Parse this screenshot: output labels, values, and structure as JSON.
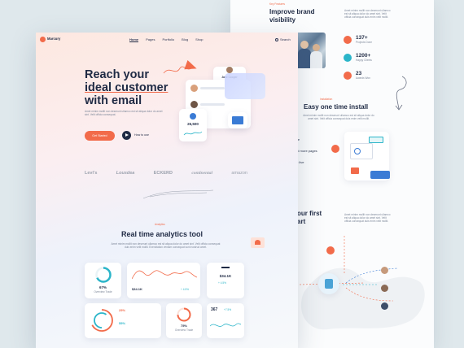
{
  "colors": {
    "accent": "#f26b4a",
    "dark": "#1f2a44",
    "teal": "#2bb5c9",
    "blue": "#3a7bd5",
    "muted": "#8a93a6"
  },
  "brand": {
    "name": "Marcury"
  },
  "nav": {
    "items": [
      "Home",
      "Pages",
      "Portfolio",
      "Blog",
      "Shop"
    ],
    "search": "Search"
  },
  "hero": {
    "line1": "Reach your",
    "line2": "ideal customer",
    "line3": "with email",
    "desc": "Amet minim mollit non deserunt ullamco est sit aliqua dolor do amet sint. Velit officia consequat.",
    "cta": "Get Started",
    "how": "How to use",
    "contact_name": "Jane Cooper",
    "stat": "26,500"
  },
  "logos": [
    "Levi's",
    "Lousdea",
    "ECKERD",
    "continental",
    "amazon"
  ],
  "analytics": {
    "tag": "Analytics",
    "title": "Real time analytics tool",
    "desc": "Amet minim mollit non deserunt ullamco est sit aliqua dolor do amet sint. Velit officia consequat duis enim velit mollit. Exercitation veniam consequat sunt nostrud amet.",
    "donut_value": "67%",
    "donut_label": "Overview Trade",
    "line_value": "$34.1K",
    "line_change": "+ 4.5%",
    "bar_value": "$34.1K",
    "bar_change": "+ 4.5%",
    "pct1": "25%",
    "pct2": "55%",
    "ring_value": "75%",
    "ring_label": "Overview Trade",
    "count_value": "367",
    "count_change": "+7.5%"
  },
  "back": {
    "feat_tag": "Key Features",
    "title1": "Improve brand",
    "title2": "visibility",
    "text": "Amet minim mollit non deserunt ullamco est sit aliqua dolor do amet sint. Velit officia consequat duis enim velit mollit.",
    "stats": [
      {
        "value": "137+",
        "label": "Projects Done"
      },
      {
        "value": "1200+",
        "label": "Happy Clients"
      },
      {
        "value": "23",
        "label": "Awards Won"
      }
    ],
    "install_tag": "Installation",
    "install_title": "Easy one time install",
    "install_desc": "Amet minim mollit non deserunt ullamco est sit aliqua dolor do amet sint. Velit officia consequat duis enim velit mollit.",
    "list": [
      "file",
      "nd more pages",
      "et live"
    ],
    "partial_title1": "our first",
    "partial_title2": "art",
    "partial_desc": "Amet minim mollit non deserunt ullamco est sit aliqua dolor do amet sint. Velit officia consequat duis enim velit mollit."
  }
}
